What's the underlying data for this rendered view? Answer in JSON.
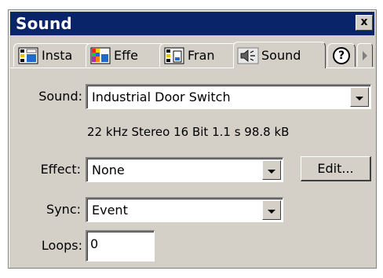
{
  "window": {
    "title": "Sound",
    "close_label": "x"
  },
  "tabs": [
    {
      "label": "Insta",
      "icon": "instance-icon"
    },
    {
      "label": "Effe",
      "icon": "effect-icon"
    },
    {
      "label": "Fran",
      "icon": "frame-icon"
    },
    {
      "label": "Sound",
      "icon": "sound-icon",
      "active": true
    }
  ],
  "help_tab": {
    "label": "?"
  },
  "form": {
    "sound": {
      "label": "Sound:",
      "value": "Industrial Door Switch"
    },
    "info": "22 kHz Stereo 16 Bit 1.1 s 98.8 kB",
    "effect": {
      "label": "Effect:",
      "value": "None",
      "button": "Edit..."
    },
    "sync": {
      "label": "Sync:",
      "value": "Event"
    },
    "loops": {
      "label": "Loops:",
      "value": "0"
    }
  },
  "colors": {
    "titlebar": "#0a246a",
    "panel": "#d4d0c8"
  }
}
